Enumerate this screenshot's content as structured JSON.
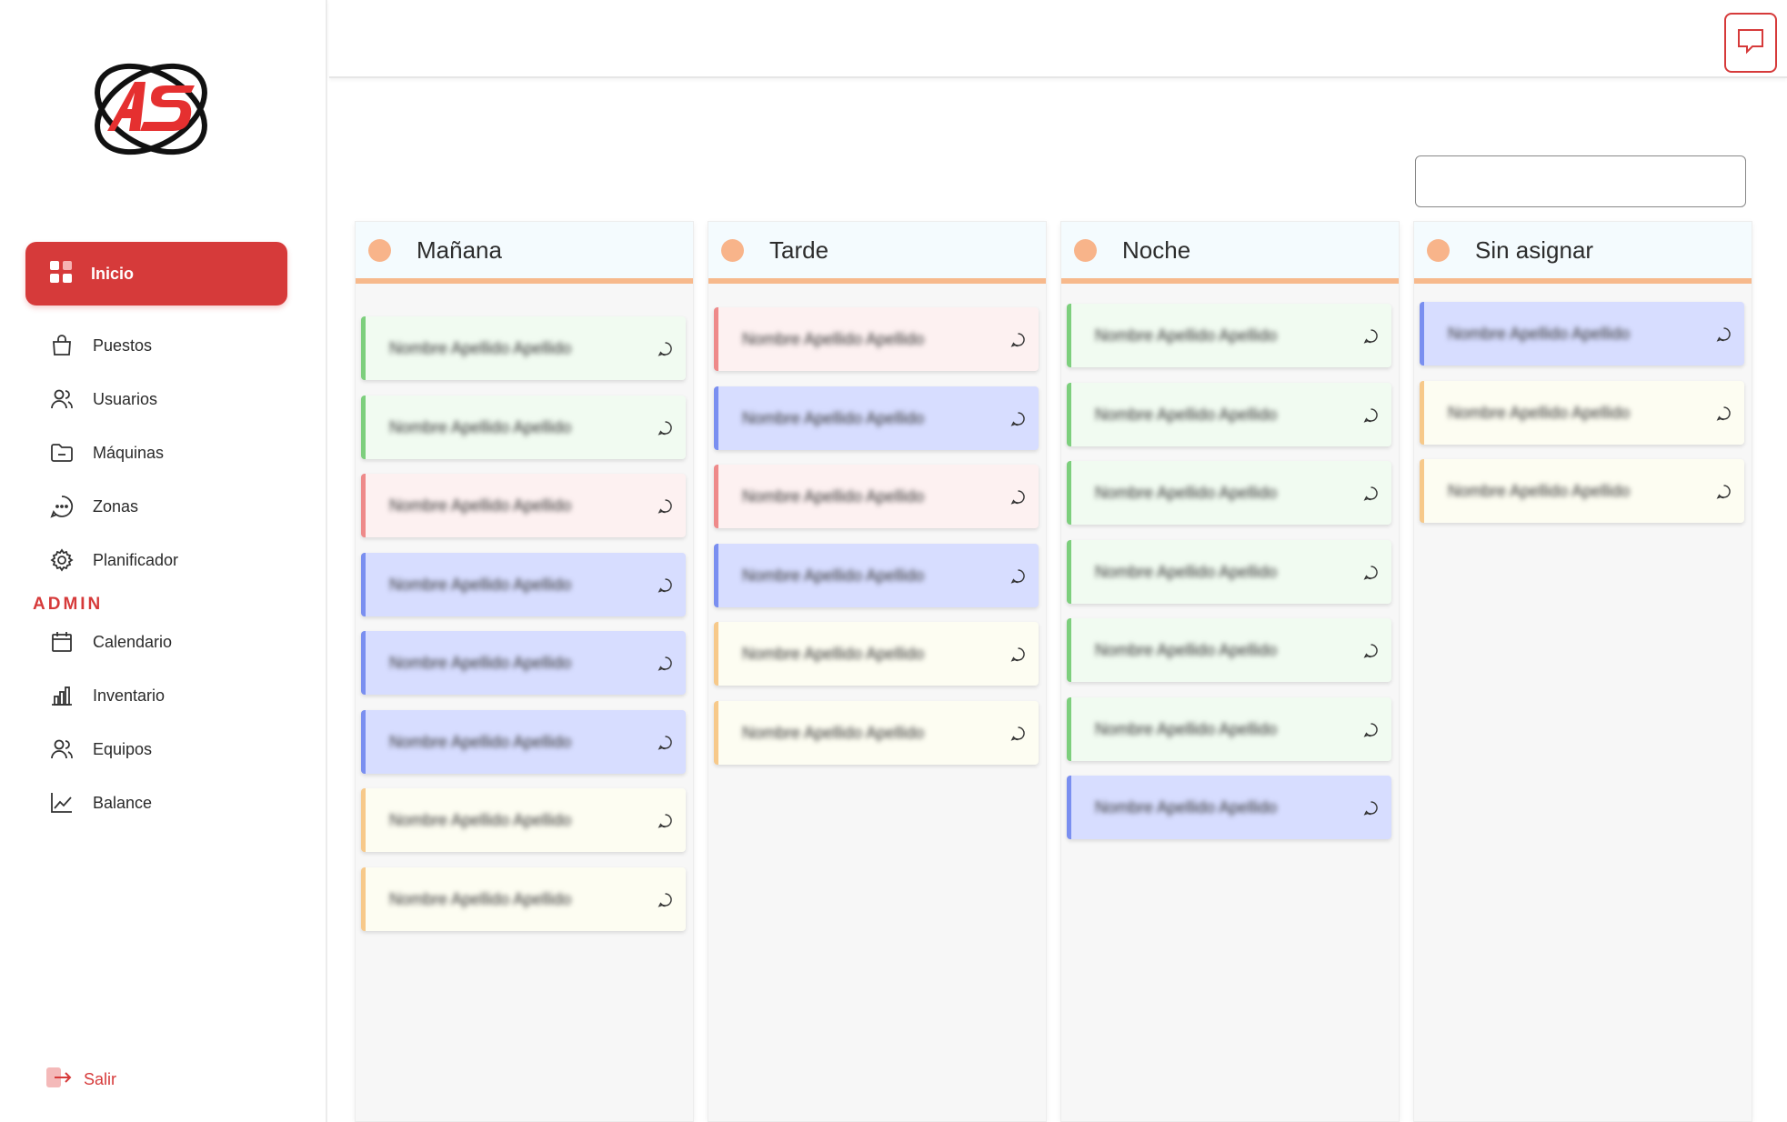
{
  "sidebar": {
    "logo_text": "AS",
    "nav": [
      {
        "label": "Inicio",
        "icon": "grid-icon",
        "active": true
      },
      {
        "label": "Puestos",
        "icon": "bag-icon"
      },
      {
        "label": "Usuarios",
        "icon": "users-icon"
      },
      {
        "label": "Máquinas",
        "icon": "folder-icon"
      },
      {
        "label": "Zonas",
        "icon": "chat-bubble-icon"
      },
      {
        "label": "Planificador",
        "icon": "gear-icon"
      }
    ],
    "admin_label": "ADMIN",
    "admin_nav": [
      {
        "label": "Calendario",
        "icon": "calendar-icon"
      },
      {
        "label": "Inventario",
        "icon": "bar-chart-icon"
      },
      {
        "label": "Equipos",
        "icon": "users-icon"
      },
      {
        "label": "Balance",
        "icon": "line-chart-icon"
      }
    ],
    "logout_label": "Salir"
  },
  "header": {
    "chat_icon": "message-square-icon",
    "search_placeholder": ""
  },
  "columns": [
    {
      "title": "Mañana",
      "cards": [
        {
          "name": "Nombre Apellido Apellido",
          "color": "green"
        },
        {
          "name": "Nombre Apellido Apellido",
          "color": "green"
        },
        {
          "name": "Nombre Apellido Apellido",
          "color": "red"
        },
        {
          "name": "Nombre Apellido Apellido",
          "color": "blue"
        },
        {
          "name": "Nombre Apellido Apellido",
          "color": "blue"
        },
        {
          "name": "Nombre Apellido Apellido",
          "color": "blue"
        },
        {
          "name": "Nombre Apellido Apellido",
          "color": "yellow"
        },
        {
          "name": "Nombre Apellido Apellido",
          "color": "yellow"
        }
      ]
    },
    {
      "title": "Tarde",
      "cards": [
        {
          "name": "Nombre Apellido Apellido",
          "color": "red"
        },
        {
          "name": "Nombre Apellido Apellido",
          "color": "blue"
        },
        {
          "name": "Nombre Apellido Apellido",
          "color": "red"
        },
        {
          "name": "Nombre Apellido Apellido",
          "color": "blue"
        },
        {
          "name": "Nombre Apellido Apellido",
          "color": "yellow"
        },
        {
          "name": "Nombre Apellido Apellido",
          "color": "yellow"
        }
      ]
    },
    {
      "title": "Noche",
      "cards": [
        {
          "name": "Nombre Apellido Apellido",
          "color": "green"
        },
        {
          "name": "Nombre Apellido Apellido",
          "color": "green"
        },
        {
          "name": "Nombre Apellido Apellido",
          "color": "green"
        },
        {
          "name": "Nombre Apellido Apellido",
          "color": "green"
        },
        {
          "name": "Nombre Apellido Apellido",
          "color": "green"
        },
        {
          "name": "Nombre Apellido Apellido",
          "color": "green"
        },
        {
          "name": "Nombre Apellido Apellido",
          "color": "blue"
        }
      ]
    },
    {
      "title": "Sin asignar",
      "cards": [
        {
          "name": "Nombre Apellido Apellido",
          "color": "blue"
        },
        {
          "name": "Nombre Apellido Apellido",
          "color": "yellow"
        },
        {
          "name": "Nombre Apellido Apellido",
          "color": "yellow"
        }
      ]
    }
  ],
  "colors": {
    "accent": "#d63a3a",
    "column_underline": "#f7b98c",
    "status_dot": "#f8b48a"
  }
}
